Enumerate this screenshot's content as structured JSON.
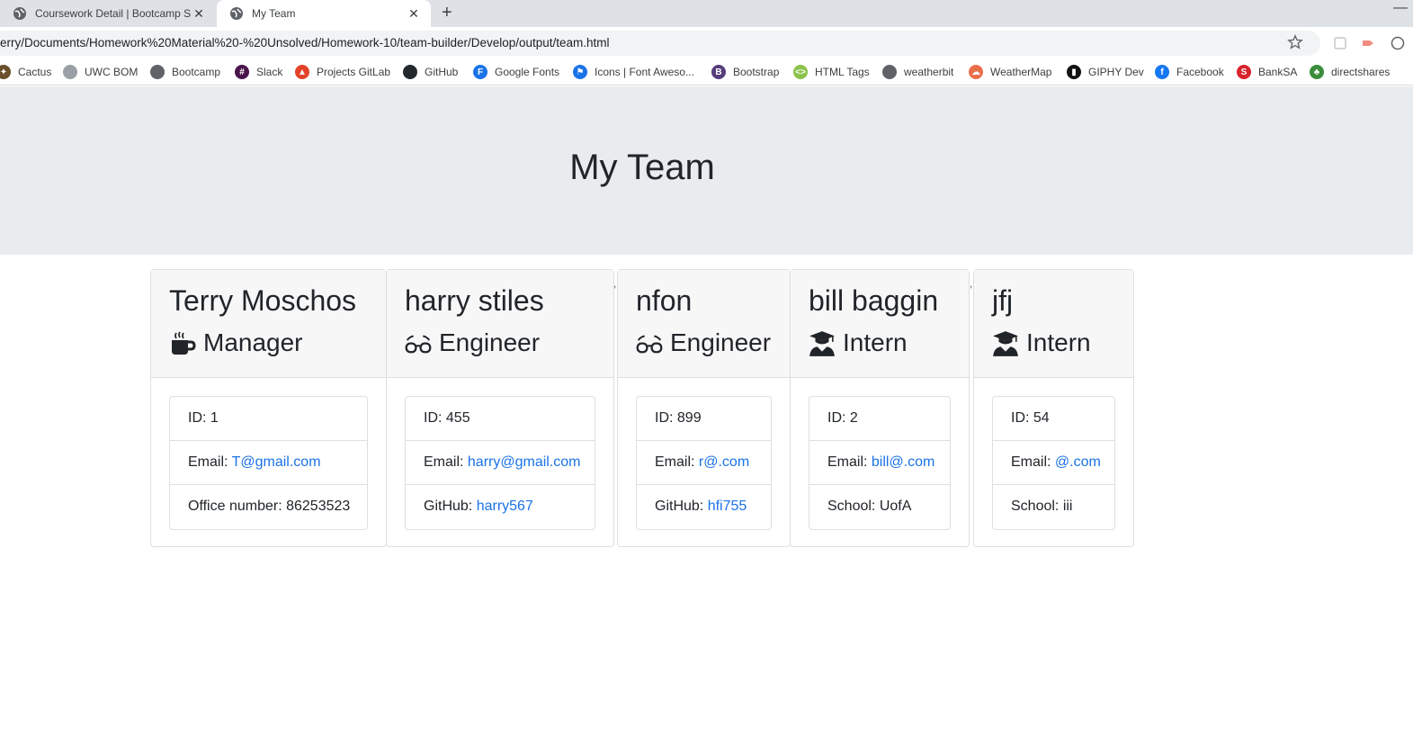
{
  "browser": {
    "tabs": [
      {
        "title": "Coursework Detail | Bootcamp Sp",
        "active": false
      },
      {
        "title": "My Team",
        "active": true
      }
    ],
    "url": "erry/Documents/Homework%20Material%20-%20Unsolved/Homework-10/team-builder/Develop/output/team.html",
    "bookmarks": [
      {
        "label": "Cactus",
        "icon": "cactus-icon",
        "color": "#6b4f2a"
      },
      {
        "label": "UWC BOM",
        "icon": "globe-icon",
        "color": "#9aa0a6"
      },
      {
        "label": "Bootcamp",
        "icon": "globe-icon",
        "color": "#5f6368"
      },
      {
        "label": "Slack",
        "icon": "slack-icon",
        "color": "#4a154b"
      },
      {
        "label": "Projects GitLab",
        "icon": "gitlab-icon",
        "color": "#e24329"
      },
      {
        "label": "GitHub",
        "icon": "github-icon",
        "color": "#24292e"
      },
      {
        "label": "Google Fonts",
        "icon": "google-fonts-icon",
        "color": "#1a73e8"
      },
      {
        "label": "Icons | Font Aweso...",
        "icon": "flag-icon",
        "color": "#1a73e8"
      },
      {
        "label": "Bootstrap",
        "icon": "bootstrap-icon",
        "color": "#563d7c"
      },
      {
        "label": "HTML Tags",
        "icon": "html-icon",
        "color": "#8bc34a"
      },
      {
        "label": "weatherbit",
        "icon": "globe-icon",
        "color": "#5f6368"
      },
      {
        "label": "WeatherMap",
        "icon": "weathermap-icon",
        "color": "#eb6e4b"
      },
      {
        "label": "GIPHY Dev",
        "icon": "giphy-icon",
        "color": "#121212"
      },
      {
        "label": "Facebook",
        "icon": "facebook-icon",
        "color": "#1877f2"
      },
      {
        "label": "BankSA",
        "icon": "banksa-icon",
        "color": "#d8232a"
      },
      {
        "label": "directshares",
        "icon": "directshares-icon",
        "color": "#3a8d3a"
      }
    ]
  },
  "page": {
    "title": "My Team"
  },
  "team": [
    {
      "name": "Terry Moschos",
      "role": "Manager",
      "role_icon": "coffee-mug-icon",
      "id_text": "ID: 1",
      "email_label": "Email: ",
      "email": "T@gmail.com",
      "extra_label": "Office number: ",
      "extra_value": "86253523",
      "extra_is_link": false
    },
    {
      "name": "harry stiles",
      "role": "Engineer",
      "role_icon": "glasses-icon",
      "id_text": "ID: 455",
      "email_label": "Email: ",
      "email": "harry@gmail.com",
      "extra_label": "GitHub: ",
      "extra_value": "harry567",
      "extra_is_link": true
    },
    {
      "name": "nfon",
      "role": "Engineer",
      "role_icon": "glasses-icon",
      "id_text": "ID: 899",
      "email_label": "Email: ",
      "email": "r@.com",
      "extra_label": "GitHub: ",
      "extra_value": "hfi755",
      "extra_is_link": true
    },
    {
      "name": "bill baggin",
      "role": "Intern",
      "role_icon": "graduate-icon",
      "id_text": "ID: 2",
      "email_label": "Email: ",
      "email": "bill@.com",
      "extra_label": "School: ",
      "extra_value": "UofA",
      "extra_is_link": false
    },
    {
      "name": "jfj",
      "role": "Intern",
      "role_icon": "graduate-icon",
      "id_text": "ID: 54",
      "email_label": "Email: ",
      "email": "@.com",
      "extra_label": "School: ",
      "extra_value": "iii",
      "extra_is_link": false
    }
  ],
  "stray_marks": [
    ",",
    ","
  ],
  "colors": {
    "link": "#1a73e8",
    "jumbotron": "#e9ecef",
    "card_header": "#f7f7f7"
  }
}
